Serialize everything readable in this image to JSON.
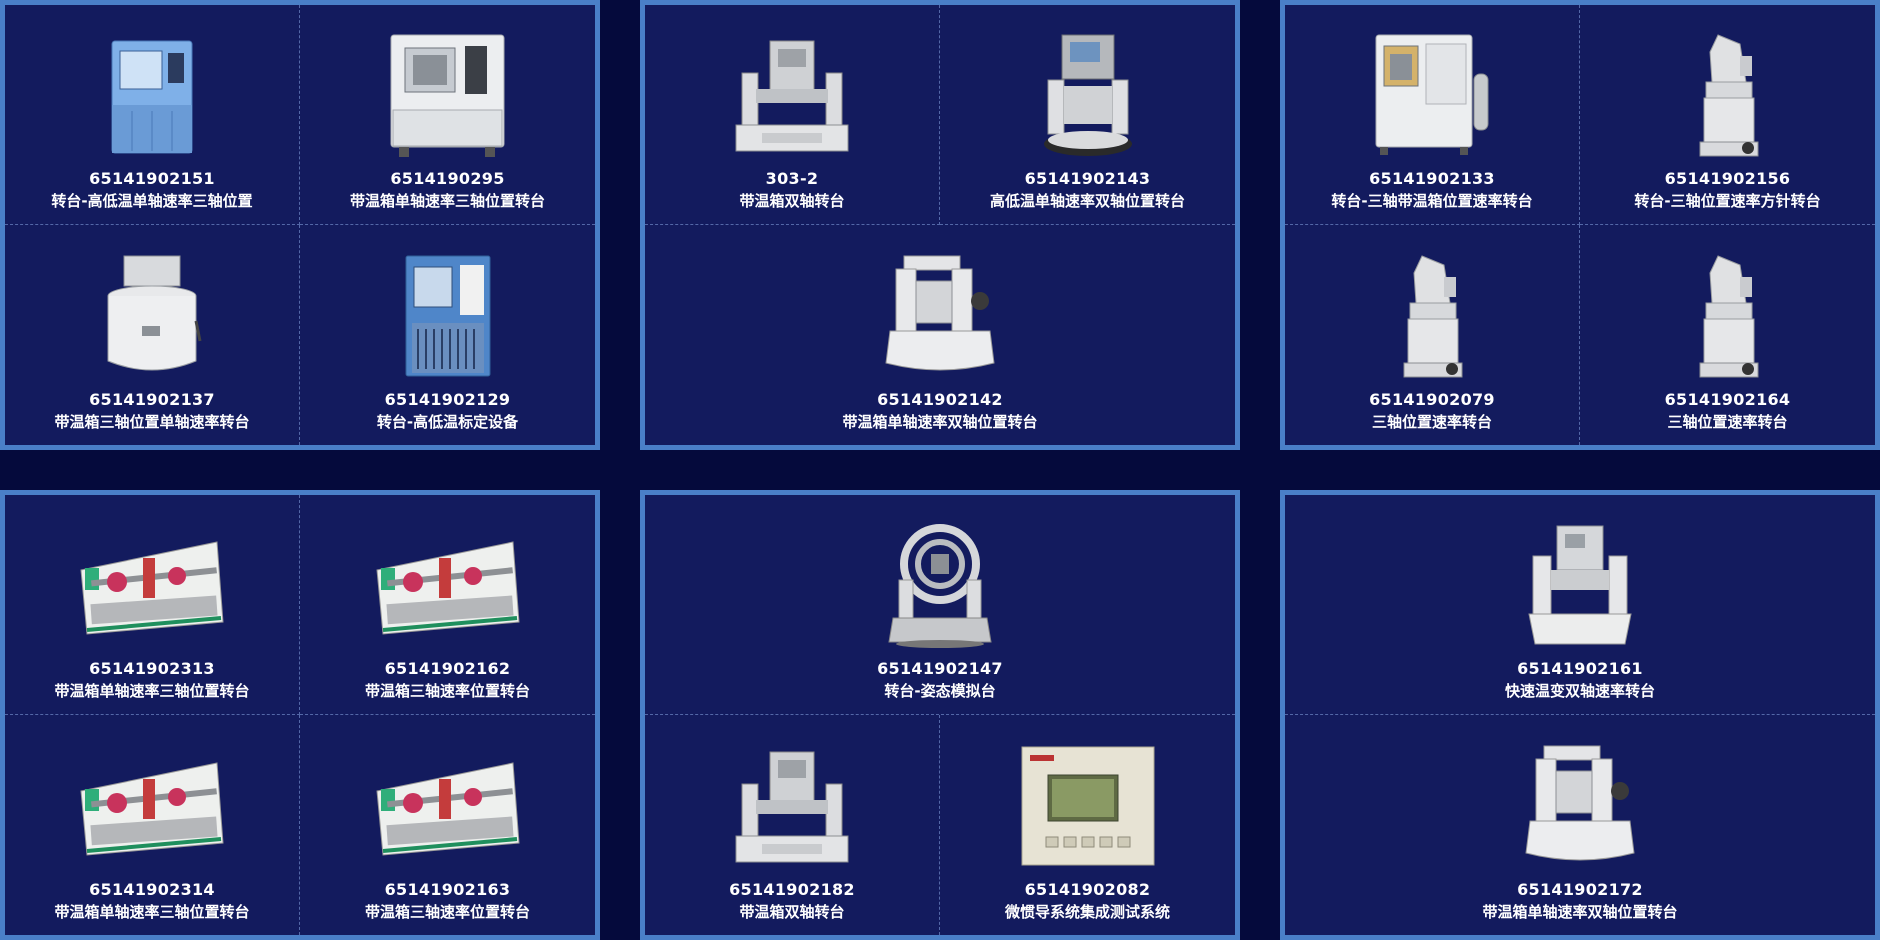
{
  "panels": [
    {
      "items": [
        {
          "code": "65141902151",
          "name": "转台-高低温单轴速率三轴位置",
          "icon": "climate-chamber-blue-icon"
        },
        {
          "code": "6514190295",
          "name": "带温箱单轴速率三轴位置转台",
          "icon": "climate-chamber-white-icon"
        },
        {
          "code": "65141902137",
          "name": "带温箱三轴位置单轴速率转台",
          "icon": "round-chamber-icon"
        },
        {
          "code": "65141902129",
          "name": "转台-高低温标定设备",
          "icon": "climate-chamber-blue-icon"
        }
      ]
    },
    {
      "items": [
        {
          "code": "303-2",
          "name": "带温箱双轴转台",
          "icon": "dual-axis-turntable-icon"
        },
        {
          "code": "65141902143",
          "name": "高低温单轴速率双轴位置转台",
          "icon": "chamber-turntable-icon"
        },
        {
          "code": "65141902142",
          "name": "带温箱单轴速率双轴位置转台",
          "icon": "yoke-turntable-icon"
        }
      ]
    },
    {
      "items": [
        {
          "code": "65141902133",
          "name": "转台-三轴带温箱位置速率转台",
          "icon": "climate-chamber-white-icon"
        },
        {
          "code": "65141902156",
          "name": "转台-三轴位置速率方针转台",
          "icon": "tower-turntable-icon"
        },
        {
          "code": "65141902079",
          "name": "三轴位置速率转台",
          "icon": "tower-turntable-icon"
        },
        {
          "code": "65141902164",
          "name": "三轴位置速率转台",
          "icon": "tower-turntable-icon"
        }
      ]
    },
    {
      "items": [
        {
          "code": "65141902313",
          "name": "带温箱单轴速率三轴位置转台",
          "icon": "slitting-machine-icon"
        },
        {
          "code": "65141902162",
          "name": "带温箱三轴速率位置转台",
          "icon": "slitting-machine-icon"
        },
        {
          "code": "65141902314",
          "name": "带温箱单轴速率三轴位置转台",
          "icon": "slitting-machine-icon"
        },
        {
          "code": "65141902163",
          "name": "带温箱三轴速率位置转台",
          "icon": "slitting-machine-icon"
        }
      ]
    },
    {
      "items": [
        {
          "code": "65141902147",
          "name": "转台-姿态模拟台",
          "icon": "gimbal-simulator-icon"
        },
        {
          "code": "65141902182",
          "name": "带温箱双轴转台",
          "icon": "dual-axis-turntable-icon"
        },
        {
          "code": "65141902082",
          "name": "微惯导系统集成测试系统",
          "icon": "control-unit-icon"
        }
      ]
    },
    {
      "items": [
        {
          "code": "65141902161",
          "name": "快速温变双轴速率转台",
          "icon": "dual-axis-turntable-icon"
        },
        {
          "code": "65141902172",
          "name": "带温箱单轴速率双轴位置转台",
          "icon": "yoke-turntable-icon"
        }
      ]
    }
  ]
}
